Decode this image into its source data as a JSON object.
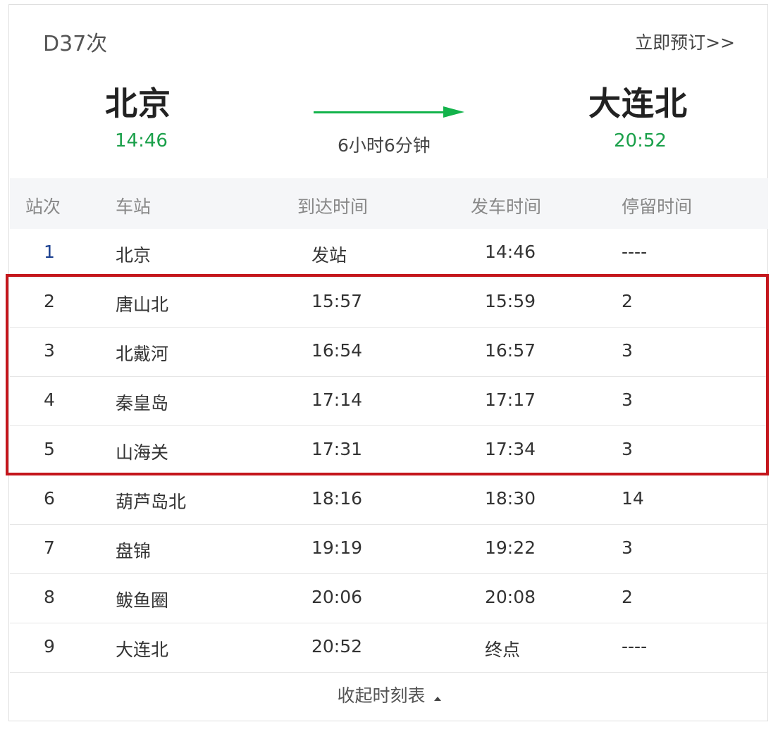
{
  "header": {
    "train_no": "D37次",
    "book_label": "立即预订>>",
    "from_station": "北京",
    "from_time": "14:46",
    "to_station": "大连北",
    "to_time": "20:52",
    "duration": "6小时6分钟"
  },
  "colors": {
    "accent_green": "#13b34b",
    "time_green": "#1aa04a",
    "highlight_red": "#c4161c"
  },
  "table": {
    "columns": [
      "站次",
      "车站",
      "到达时间",
      "发车时间",
      "停留时间"
    ],
    "rows": [
      {
        "no": "1",
        "station": "北京",
        "arrive": "发站",
        "depart": "14:46",
        "stay": "----"
      },
      {
        "no": "2",
        "station": "唐山北",
        "arrive": "15:57",
        "depart": "15:59",
        "stay": "2"
      },
      {
        "no": "3",
        "station": "北戴河",
        "arrive": "16:54",
        "depart": "16:57",
        "stay": "3"
      },
      {
        "no": "4",
        "station": "秦皇岛",
        "arrive": "17:14",
        "depart": "17:17",
        "stay": "3"
      },
      {
        "no": "5",
        "station": "山海关",
        "arrive": "17:31",
        "depart": "17:34",
        "stay": "3"
      },
      {
        "no": "6",
        "station": "葫芦岛北",
        "arrive": "18:16",
        "depart": "18:30",
        "stay": "14"
      },
      {
        "no": "7",
        "station": "盘锦",
        "arrive": "19:19",
        "depart": "19:22",
        "stay": "3"
      },
      {
        "no": "8",
        "station": "鲅鱼圈",
        "arrive": "20:06",
        "depart": "20:08",
        "stay": "2"
      },
      {
        "no": "9",
        "station": "大连北",
        "arrive": "20:52",
        "depart": "终点",
        "stay": "----"
      }
    ]
  },
  "footer": {
    "collapse_label": "收起时刻表",
    "caret_icon": "caret-up-icon"
  }
}
